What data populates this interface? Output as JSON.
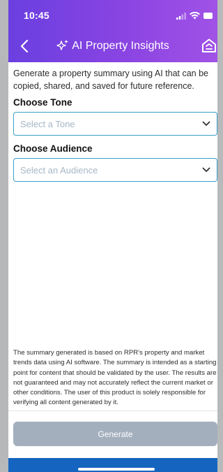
{
  "status_bar": {
    "time": "10:45"
  },
  "nav": {
    "title": "AI Property Insights"
  },
  "intro_text": "Generate a property summary using AI that can be copied, shared, and saved for future reference.",
  "tone": {
    "label": "Choose Tone",
    "placeholder": "Select a Tone"
  },
  "audience": {
    "label": "Choose Audience",
    "placeholder": "Select an Audience"
  },
  "disclaimer": "The summary generated is based on RPR's property and market trends data using AI software. The summary is intended as a starting point for content that should be validated by the user. The results are not guaranteed and may not accurately reflect the current market or other conditions. The user of this product is solely responsible for verifying all content generated by it.",
  "generate_button": {
    "label": "Generate",
    "enabled": false
  },
  "colors": {
    "header_start": "#6a3fe0",
    "header_end": "#a152e6",
    "select_border": "#3aa0c8",
    "button_disabled": "#a3afbd",
    "bottom_bar": "#1565c0"
  },
  "icons": [
    "signal-icon",
    "wifi-icon",
    "battery-icon",
    "back-arrow-icon",
    "sparkle-icon",
    "home-icon",
    "chevron-down-icon"
  ]
}
